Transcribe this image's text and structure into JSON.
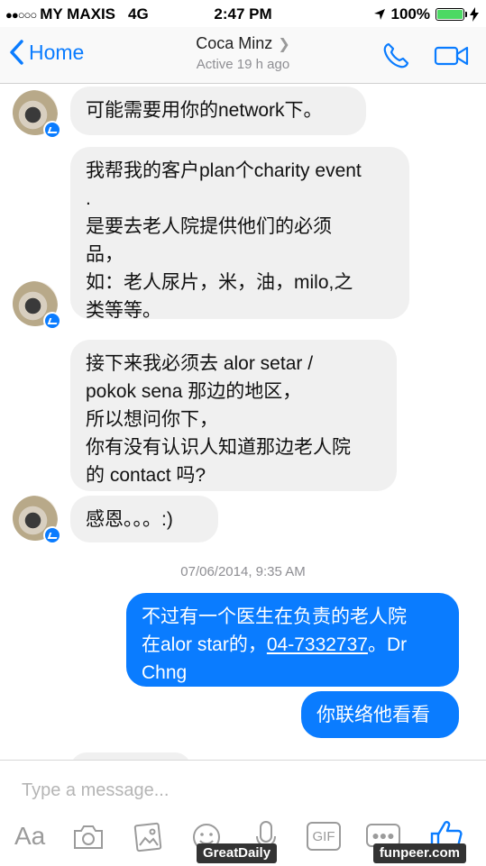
{
  "status_bar": {
    "carrier": "MY MAXIS",
    "network": "4G",
    "time": "2:47 PM",
    "battery": "100%",
    "battery_level": 1.0
  },
  "header": {
    "back_label": "Home",
    "contact_name": "Coca Minz",
    "active_status": "Active 19 h ago"
  },
  "messages": [
    {
      "text": "可能需要用你的network下。"
    },
    {
      "text": "我帮我的客户plan个charity event\n.\n是要去老人院提供他们的必须\n品，\n如：老人尿片，米，油，milo,之\n类等等。"
    },
    {
      "text": "接下来我必须去 alor setar /\npokok sena 那边的地区，\n所以想问你下，\n你有没有认识人知道那边老人院\n的 contact 吗?"
    },
    {
      "text": "感恩。。。:)"
    }
  ],
  "timestamp": "07/06/2014, 9:35 AM",
  "outgoing": {
    "line1": "不过有一个医生在负责的老人院",
    "line2_prefix": "在alor star的，",
    "phone": "04-7332737",
    "line2_suffix": "。Dr",
    "line3": "Chng",
    "second_message": "你联络他看看"
  },
  "composer": {
    "placeholder": "Type a message...",
    "text_tool": "Aa",
    "gif_tool": "GIF"
  },
  "watermarks": {
    "left": "GreatDaily",
    "right": "funpeer.com"
  }
}
